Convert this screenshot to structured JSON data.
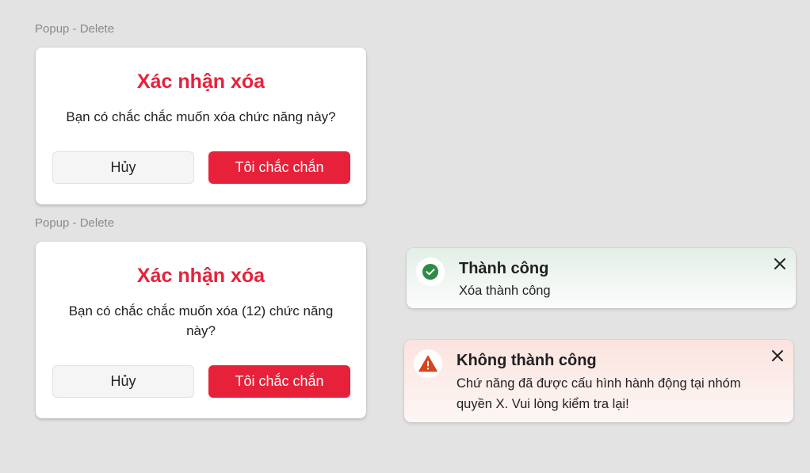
{
  "popups": [
    {
      "frame_label": "Popup - Delete",
      "title": "Xác nhận xóa",
      "message": "Bạn có chắc chắc muốn xóa chức năng này?",
      "cancel_label": "Hủy",
      "confirm_label": "Tôi chắc chắn"
    },
    {
      "frame_label": "Popup - Delete",
      "title": "Xác nhận xóa",
      "message": "Bạn có chắc chắc muốn xóa (12) chức năng này?",
      "cancel_label": "Hủy",
      "confirm_label": "Tôi chắc chắn"
    }
  ],
  "toasts": {
    "success": {
      "title": "Thành công",
      "message": "Xóa thành công",
      "icon": "check-circle-icon",
      "color": "#2e8b45"
    },
    "error": {
      "title": "Không thành công",
      "message": "Chứ năng đã được cấu hình hành động tại nhóm quyền X. Vui lòng kiểm tra lại!",
      "icon": "warning-triangle-icon",
      "color": "#d9441f"
    }
  },
  "colors": {
    "accent": "#e8213a",
    "background": "#e3e3e3"
  }
}
